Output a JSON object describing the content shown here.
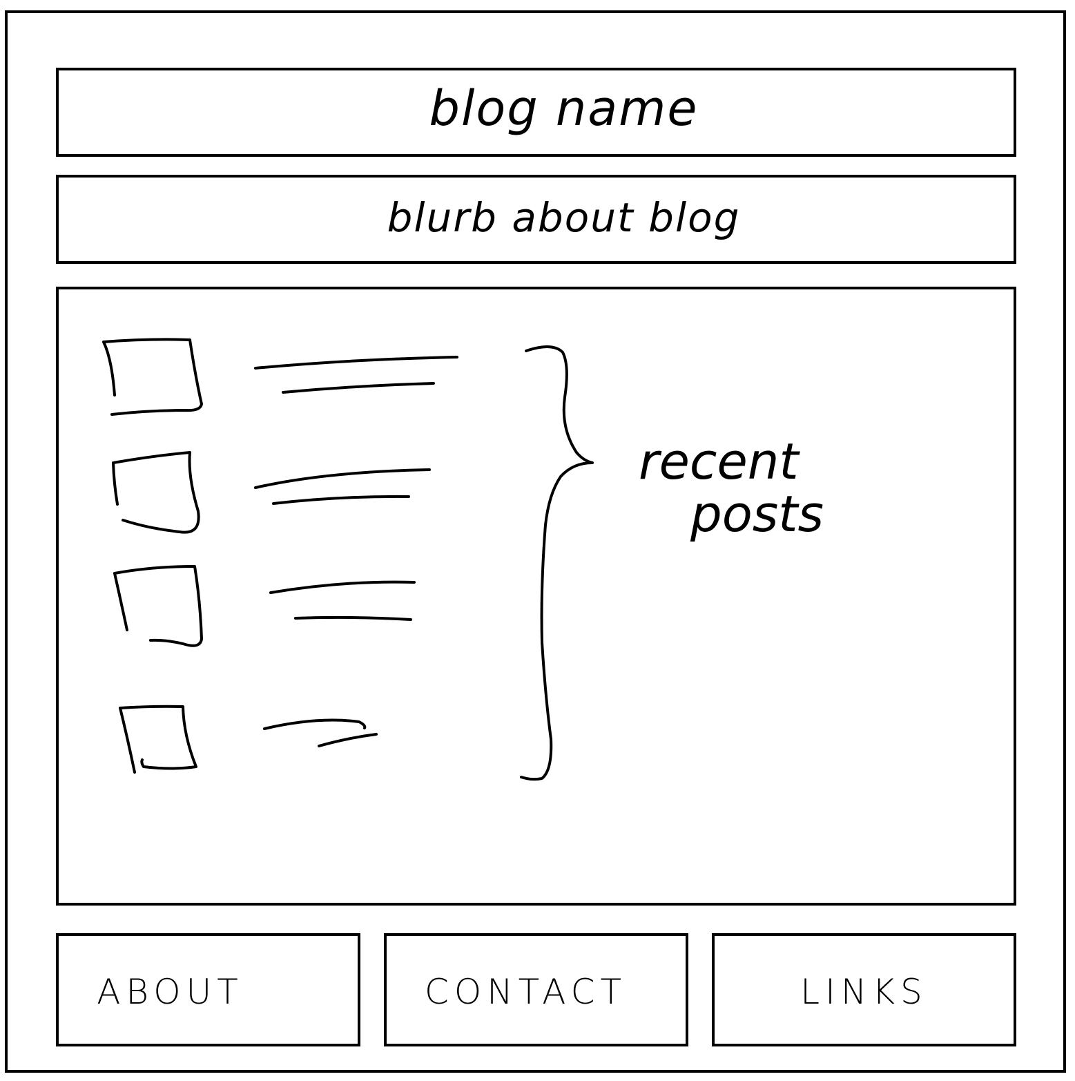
{
  "header": {
    "title": "blog name"
  },
  "blurb": {
    "text": "blurb about blog"
  },
  "main": {
    "annotation": {
      "line1": "recent",
      "line2": "posts"
    },
    "posts": [
      {
        "thumbnail": "image-placeholder"
      },
      {
        "thumbnail": "image-placeholder"
      },
      {
        "thumbnail": "image-placeholder"
      },
      {
        "thumbnail": "image-placeholder"
      }
    ]
  },
  "nav": {
    "about": "ABOUT",
    "contact": "CONTACT",
    "links": "LINKS"
  },
  "colors": {
    "stroke": "#000000",
    "background": "#ffffff"
  }
}
